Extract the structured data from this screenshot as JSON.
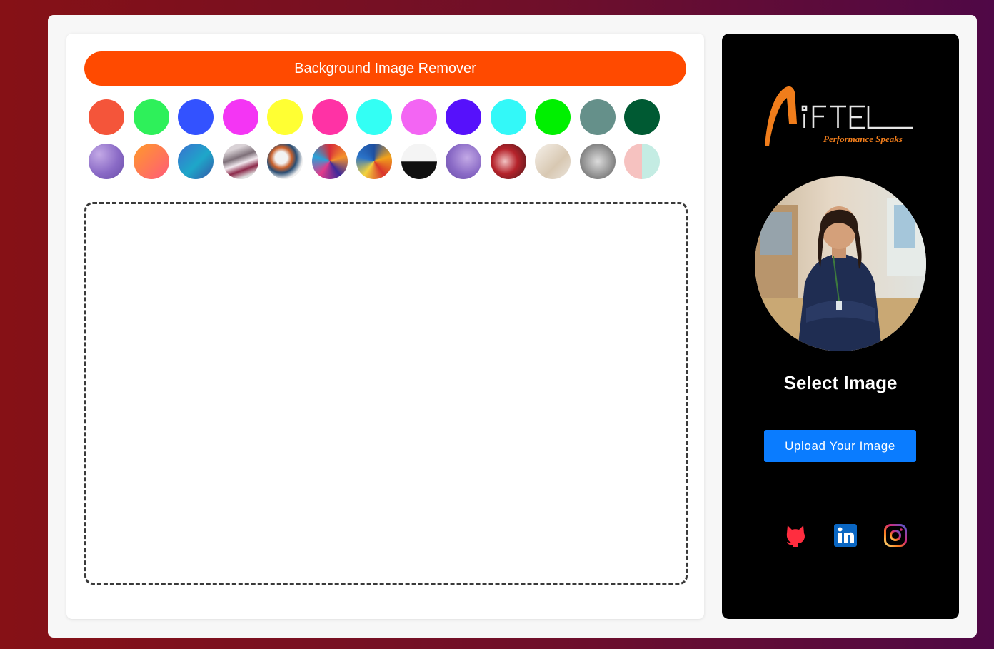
{
  "header": {
    "title": "Background Image Remover"
  },
  "swatches": {
    "colors": [
      "#f4553a",
      "#2ef05a",
      "#3352ff",
      "#f435f4",
      "#ffff33",
      "#ff32a5",
      "#33fff4",
      "#f365f3",
      "#5611fb",
      "#33f8f8",
      "#00f000",
      "#65908a",
      "#005a33"
    ],
    "image_swatch_icons": [
      "purple-marble-swatch-icon",
      "orange-pink-gradient-swatch-icon",
      "blue-teal-gradient-swatch-icon",
      "grey-pink-swirl-swatch-icon",
      "paint-splash-swatch-icon",
      "rainbow-swirl-swatch-icon",
      "colorful-fluid-swatch-icon",
      "black-white-red-swatch-icon",
      "purple-marble-swatch-icon",
      "red-marble-swatch-icon",
      "white-interior-swatch-icon",
      "water-drops-swatch-icon",
      "pink-mint-swatch-icon"
    ]
  },
  "profile": {
    "brand": "IFTEL",
    "tagline": "Performance Speaks",
    "select_title": "Select Image",
    "upload_label": "Upload Your Image",
    "social_icons": [
      "github-icon",
      "linkedin-icon",
      "instagram-icon"
    ]
  },
  "colors": {
    "accent": "#ff4a00",
    "button": "#0a7cff",
    "panel": "#000000"
  }
}
